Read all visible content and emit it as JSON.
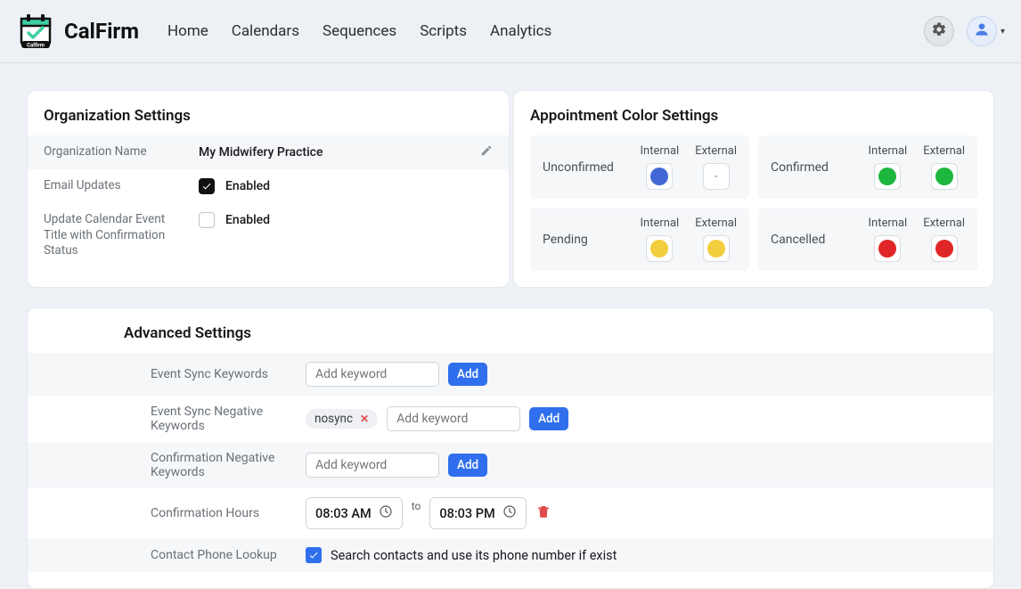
{
  "header": {
    "brand": "CalFirm",
    "nav": [
      "Home",
      "Calendars",
      "Sequences",
      "Scripts",
      "Analytics"
    ]
  },
  "org": {
    "title": "Organization Settings",
    "rows": {
      "name_label": "Organization Name",
      "name_value": "My Midwifery Practice",
      "email_label": "Email Updates",
      "email_value": "Enabled",
      "title_label": "Update Calendar Event Title with Confirmation Status",
      "title_value": "Enabled"
    }
  },
  "colors": {
    "title": "Appointment Color Settings",
    "labels": {
      "internal": "Internal",
      "external": "External"
    },
    "statuses": {
      "unconfirmed": {
        "name": "Unconfirmed",
        "internal": "#4268d6",
        "external": null
      },
      "confirmed": {
        "name": "Confirmed",
        "internal": "#1db63e",
        "external": "#1db63e"
      },
      "pending": {
        "name": "Pending",
        "internal": "#f2ce3e",
        "external": "#f2ce3e"
      },
      "cancelled": {
        "name": "Cancelled",
        "internal": "#e02626",
        "external": "#e02626"
      }
    }
  },
  "advanced": {
    "title": "Advanced Settings",
    "sync_keywords": {
      "label": "Event Sync Keywords",
      "placeholder": "Add keyword",
      "add": "Add"
    },
    "neg_keywords": {
      "label": "Event Sync Negative Keywords",
      "placeholder": "Add keyword",
      "add": "Add",
      "tag": "nosync"
    },
    "conf_neg": {
      "label": "Confirmation Negative Keywords",
      "placeholder": "Add keyword",
      "add": "Add"
    },
    "conf_hours": {
      "label": "Confirmation Hours",
      "from": "08:03 AM",
      "to_text": "to",
      "to": "08:03 PM"
    },
    "lookup": {
      "label": "Contact Phone Lookup",
      "text": "Search contacts and use its phone number if exist"
    }
  }
}
